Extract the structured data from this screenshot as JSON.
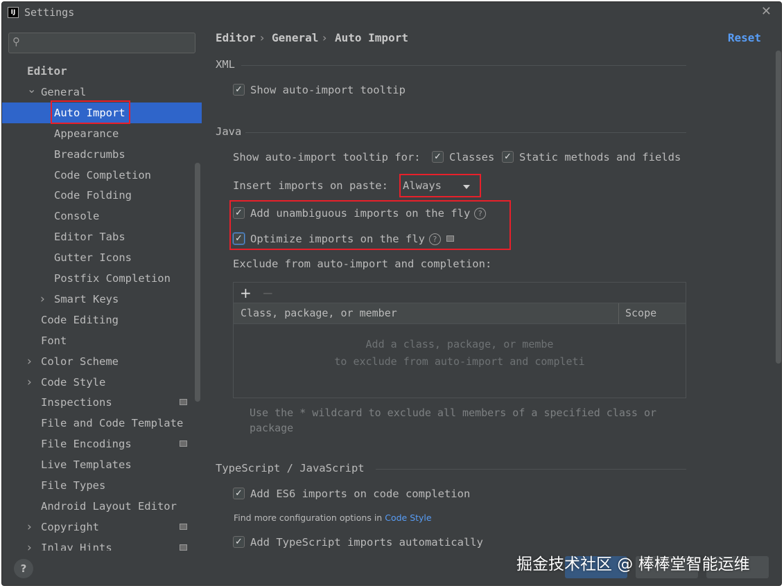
{
  "window": {
    "title": "Settings"
  },
  "sidebar": {
    "search_placeholder": "",
    "items": [
      {
        "label": "Editor",
        "level": 0,
        "expander": ""
      },
      {
        "label": "General",
        "level": 1,
        "expander": "expanded"
      },
      {
        "label": "Auto Import",
        "level": 2,
        "expander": "",
        "selected": true
      },
      {
        "label": "Appearance",
        "level": 2,
        "expander": ""
      },
      {
        "label": "Breadcrumbs",
        "level": 2,
        "expander": ""
      },
      {
        "label": "Code Completion",
        "level": 2,
        "expander": ""
      },
      {
        "label": "Code Folding",
        "level": 2,
        "expander": ""
      },
      {
        "label": "Console",
        "level": 2,
        "expander": ""
      },
      {
        "label": "Editor Tabs",
        "level": 2,
        "expander": ""
      },
      {
        "label": "Gutter Icons",
        "level": 2,
        "expander": ""
      },
      {
        "label": "Postfix Completion",
        "level": 2,
        "expander": ""
      },
      {
        "label": "Smart Keys",
        "level": 2,
        "expander": "collapsed"
      },
      {
        "label": "Code Editing",
        "level": 1,
        "expander": ""
      },
      {
        "label": "Font",
        "level": 1,
        "expander": ""
      },
      {
        "label": "Color Scheme",
        "level": 1,
        "expander": "collapsed"
      },
      {
        "label": "Code Style",
        "level": 1,
        "expander": "collapsed"
      },
      {
        "label": "Inspections",
        "level": 1,
        "expander": "",
        "badge": true
      },
      {
        "label": "File and Code Template",
        "level": 1,
        "expander": ""
      },
      {
        "label": "File Encodings",
        "level": 1,
        "expander": "",
        "badge": true
      },
      {
        "label": "Live Templates",
        "level": 1,
        "expander": ""
      },
      {
        "label": "File Types",
        "level": 1,
        "expander": ""
      },
      {
        "label": "Android Layout Editor",
        "level": 1,
        "expander": ""
      },
      {
        "label": "Copyright",
        "level": 1,
        "expander": "collapsed",
        "badge": true
      },
      {
        "label": "Inlay Hints",
        "level": 1,
        "expander": "collapsed",
        "badge": true
      }
    ]
  },
  "breadcrumb": {
    "parts": [
      "Editor",
      "General",
      "Auto Import"
    ],
    "separator": "›"
  },
  "reset_label": "Reset",
  "xml": {
    "title": "XML",
    "show_tooltip": {
      "label": "Show auto-import tooltip",
      "checked": true
    }
  },
  "java": {
    "title": "Java",
    "tooltip_for_label": "Show auto-import tooltip for:",
    "classes": {
      "label": "Classes",
      "checked": true
    },
    "static_methods": {
      "label": "Static methods and fields",
      "checked": true
    },
    "insert_on_paste_label": "Insert imports on paste:",
    "insert_on_paste_value": "Always",
    "add_unambiguous": {
      "label": "Add unambiguous imports on the fly",
      "checked": true
    },
    "optimize": {
      "label": "Optimize imports on the fly",
      "checked": true
    },
    "exclude_label": "Exclude from auto-import and completion:",
    "table": {
      "columns": [
        "Class, package, or member",
        "Scope"
      ],
      "empty_line1": "Add a class, package, or membe",
      "empty_line2": "to exclude from auto-import and completi"
    },
    "hint": "Use the * wildcard to exclude all members of a specified class or package"
  },
  "typescript": {
    "title": "TypeScript / JavaScript",
    "es6": {
      "label": "Add ES6 imports on code completion",
      "checked": true
    },
    "more_options_prefix": "Find more configuration options in",
    "more_options_link": "Code Style",
    "ts_auto": {
      "label": "Add TypeScript imports automatically",
      "checked": true
    }
  },
  "footer": {
    "help_label": "?"
  },
  "watermark": "掘金技术社区 @ 棒棒堂智能运维",
  "colors": {
    "accent": "#2f65ca",
    "highlight": "#e8202a",
    "link": "#589df6",
    "background": "#3c3f41"
  }
}
